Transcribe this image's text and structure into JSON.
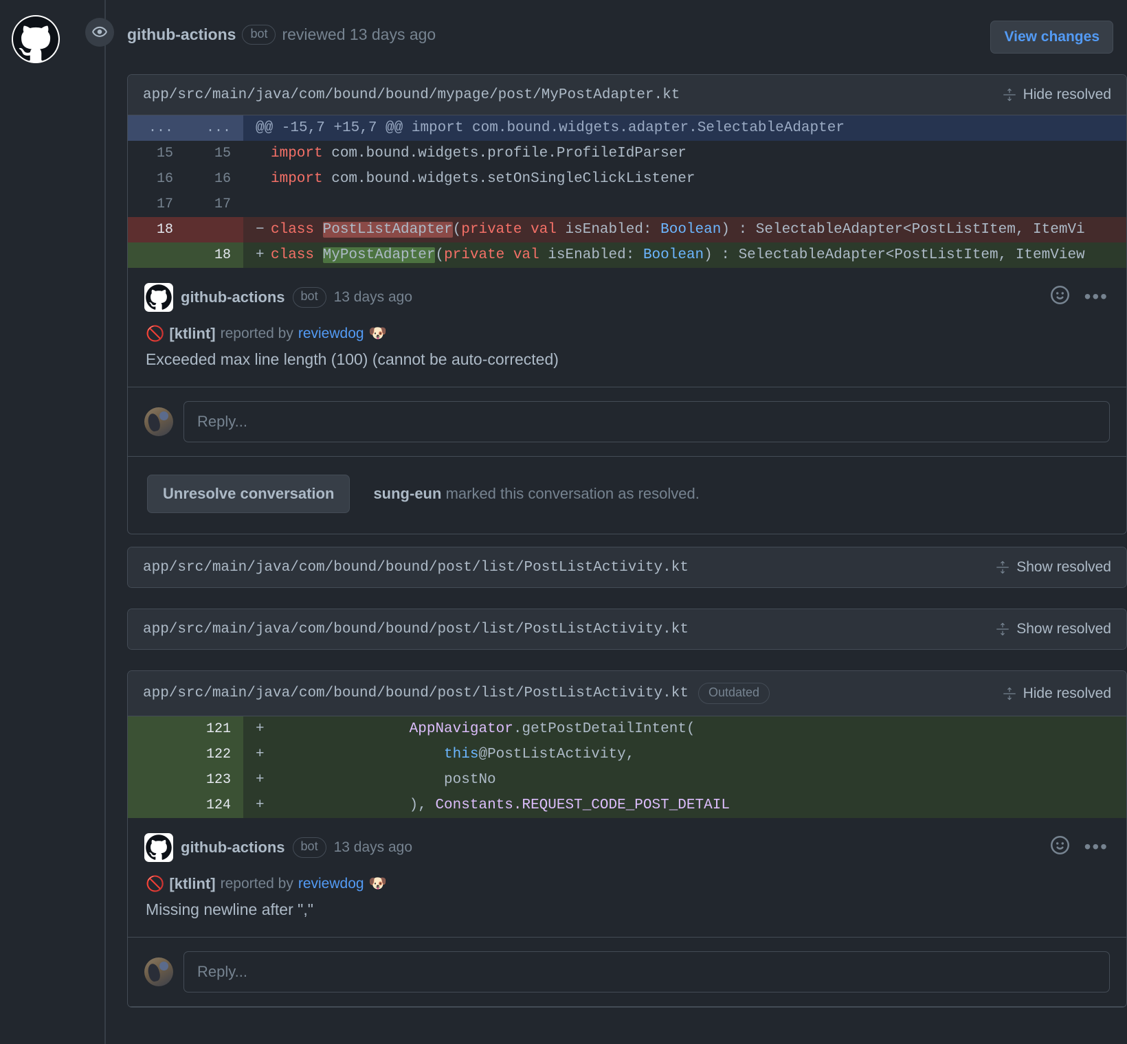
{
  "review": {
    "actor": "github-actions",
    "bot_label": "bot",
    "action_text": "reviewed 13 days ago",
    "view_changes_label": "View changes",
    "avatar_icon": "github-mark-icon",
    "event_icon": "eye-icon"
  },
  "threads": [
    {
      "file_path": "app/src/main/java/com/bound/bound/mypage/post/MyPostAdapter.kt",
      "resolve_toggle_label": "Hide resolved",
      "outdated_badge": null,
      "diff": {
        "hunk_header": "@@ -15,7 +15,7 @@ import com.bound.widgets.adapter.SelectableAdapter",
        "hunk_ellipsis": "...",
        "rows": [
          {
            "type": "ctx",
            "old": "15",
            "new": "15",
            "sign": "",
            "code_plain": "import com.bound.widgets.profile.ProfileIdParser"
          },
          {
            "type": "ctx",
            "old": "16",
            "new": "16",
            "sign": "",
            "code_plain": "import com.bound.widgets.setOnSingleClickListener"
          },
          {
            "type": "ctx",
            "old": "17",
            "new": "17",
            "sign": "",
            "code_plain": ""
          },
          {
            "type": "del",
            "old": "18",
            "new": "",
            "sign": "-",
            "code_plain": "class PostListAdapter(private val isEnabled: Boolean) : SelectableAdapter<PostListItem, ItemVi"
          },
          {
            "type": "add",
            "old": "",
            "new": "18",
            "sign": "+",
            "code_plain": "class MyPostAdapter(private val isEnabled: Boolean) : SelectableAdapter<PostListItem, ItemView"
          }
        ]
      },
      "comment": {
        "actor": "github-actions",
        "bot_label": "bot",
        "time": "13 days ago",
        "lint_icon": "no-entry-icon",
        "lint_tag": "[ktlint]",
        "reported_by_text": "reported by",
        "reporter": "reviewdog",
        "reporter_emoji": "dog-face-emoji",
        "message": "Exceeded max line length (100) (cannot be auto-corrected)",
        "reaction_icon": "smiley-face-icon",
        "menu_icon": "kebab-menu-icon"
      },
      "reply": {
        "placeholder": "Reply...",
        "value": ""
      },
      "resolution": {
        "button_label": "Unresolve conversation",
        "actor": "sung-eun",
        "text": "marked this conversation as resolved."
      }
    },
    {
      "file_path": "app/src/main/java/com/bound/bound/post/list/PostListActivity.kt",
      "resolve_toggle_label": "Show resolved",
      "outdated_badge": null,
      "collapsed": true
    },
    {
      "file_path": "app/src/main/java/com/bound/bound/post/list/PostListActivity.kt",
      "resolve_toggle_label": "Show resolved",
      "outdated_badge": null,
      "collapsed": true
    },
    {
      "file_path": "app/src/main/java/com/bound/bound/post/list/PostListActivity.kt",
      "resolve_toggle_label": "Hide resolved",
      "outdated_badge": "Outdated",
      "diff": {
        "rows": [
          {
            "type": "add",
            "old": "",
            "new": "121",
            "sign": "+",
            "code_plain": "                AppNavigator.getPostDetailIntent("
          },
          {
            "type": "add",
            "old": "",
            "new": "122",
            "sign": "+",
            "code_plain": "                    this@PostListActivity,"
          },
          {
            "type": "add",
            "old": "",
            "new": "123",
            "sign": "+",
            "code_plain": "                    postNo"
          },
          {
            "type": "add",
            "old": "",
            "new": "124",
            "sign": "+",
            "code_plain": "                ), Constants.REQUEST_CODE_POST_DETAIL"
          }
        ]
      },
      "comment": {
        "actor": "github-actions",
        "bot_label": "bot",
        "time": "13 days ago",
        "lint_icon": "no-entry-icon",
        "lint_tag": "[ktlint]",
        "reported_by_text": "reported by",
        "reporter": "reviewdog",
        "reporter_emoji": "dog-face-emoji",
        "message": "Missing newline after \",\"",
        "reaction_icon": "smiley-face-icon",
        "menu_icon": "kebab-menu-icon"
      },
      "reply": {
        "placeholder": "Reply...",
        "value": ""
      }
    }
  ],
  "colors": {
    "background": "#22272e",
    "panel": "#2d333b",
    "border": "#444c56",
    "accent_link": "#539bf5",
    "text": "#adbac7",
    "muted": "#768390",
    "diff_add_bg": "#2c3a2b",
    "diff_del_bg": "#442b2b",
    "hunk_bg": "#263450"
  }
}
